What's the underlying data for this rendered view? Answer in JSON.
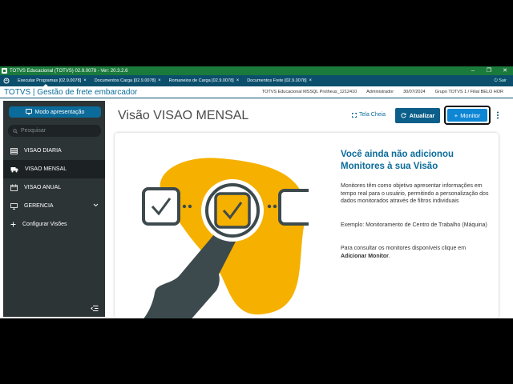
{
  "window": {
    "title": "TOTVS Educacional (TOTVS) 02.9.0078 - Ver: 20.3.2.6",
    "controls": [
      "minimize-icon",
      "maximize-icon",
      "close-icon"
    ]
  },
  "tabs": [
    {
      "label": "Executar Programas [02.9.0078]",
      "active": true
    },
    {
      "label": "Documentos Carga [02.9.0078]",
      "active": false
    },
    {
      "label": "Romaneios de Carga [02.9.0078]",
      "active": false
    },
    {
      "label": "Documentos Frete [02.9.0078]",
      "active": false
    }
  ],
  "tab_close_glyph": "×",
  "logout_label": "Sair",
  "header": {
    "brand": "TOTVS | Gestão de frete embarcador",
    "env": "TOTVS Educacional MSSQL Protheus_1212410",
    "user": "Administrador",
    "date": "30/07/2024",
    "group": "Grupo TOTVS 1 / Filial BELO HOR"
  },
  "sidebar": {
    "mode_button": "Modo apresentação",
    "search_placeholder": "Pesquisar",
    "items": [
      {
        "label": "VISAO DIARIA",
        "icon": "layers-icon",
        "active": false
      },
      {
        "label": "VISAO MENSAL",
        "icon": "truck-icon",
        "active": true
      },
      {
        "label": "VISAO ANUAL",
        "icon": "calendar-icon",
        "active": false
      },
      {
        "label": "GERENCIA",
        "icon": "monitor-icon",
        "active": false,
        "expandable": true
      },
      {
        "label": "Configurar Visões",
        "icon": "plus-icon",
        "active": false
      }
    ]
  },
  "main": {
    "title": "Visão VISAO MENSAL",
    "fullscreen_label": "Tela Cheia",
    "refresh_label": "Atualizar",
    "monitor_label": "Monitor",
    "empty_state": {
      "title": "Você ainda não adicionou Monitores à sua Visão",
      "description": "Monitores têm como objetivo apresentar informações em tempo real para o usuário, permitindo a personalização dos dados monitorados através de filtros individuais",
      "example": "Exemplo: Monitoramento de Centro de Trabalho (Máquina)",
      "consult_prefix": "Para consultar os monitores disponíveis clique em",
      "consult_action": "Adicionar Monitor",
      "consult_suffix": "."
    }
  },
  "colors": {
    "titlebar": "#1a7a3c",
    "tabbar": "#0b4f6c",
    "brand": "#0b6b9a",
    "sidebar": "#2d3436",
    "accent": "#0d86d4",
    "illustration_blob": "#f6b100"
  }
}
